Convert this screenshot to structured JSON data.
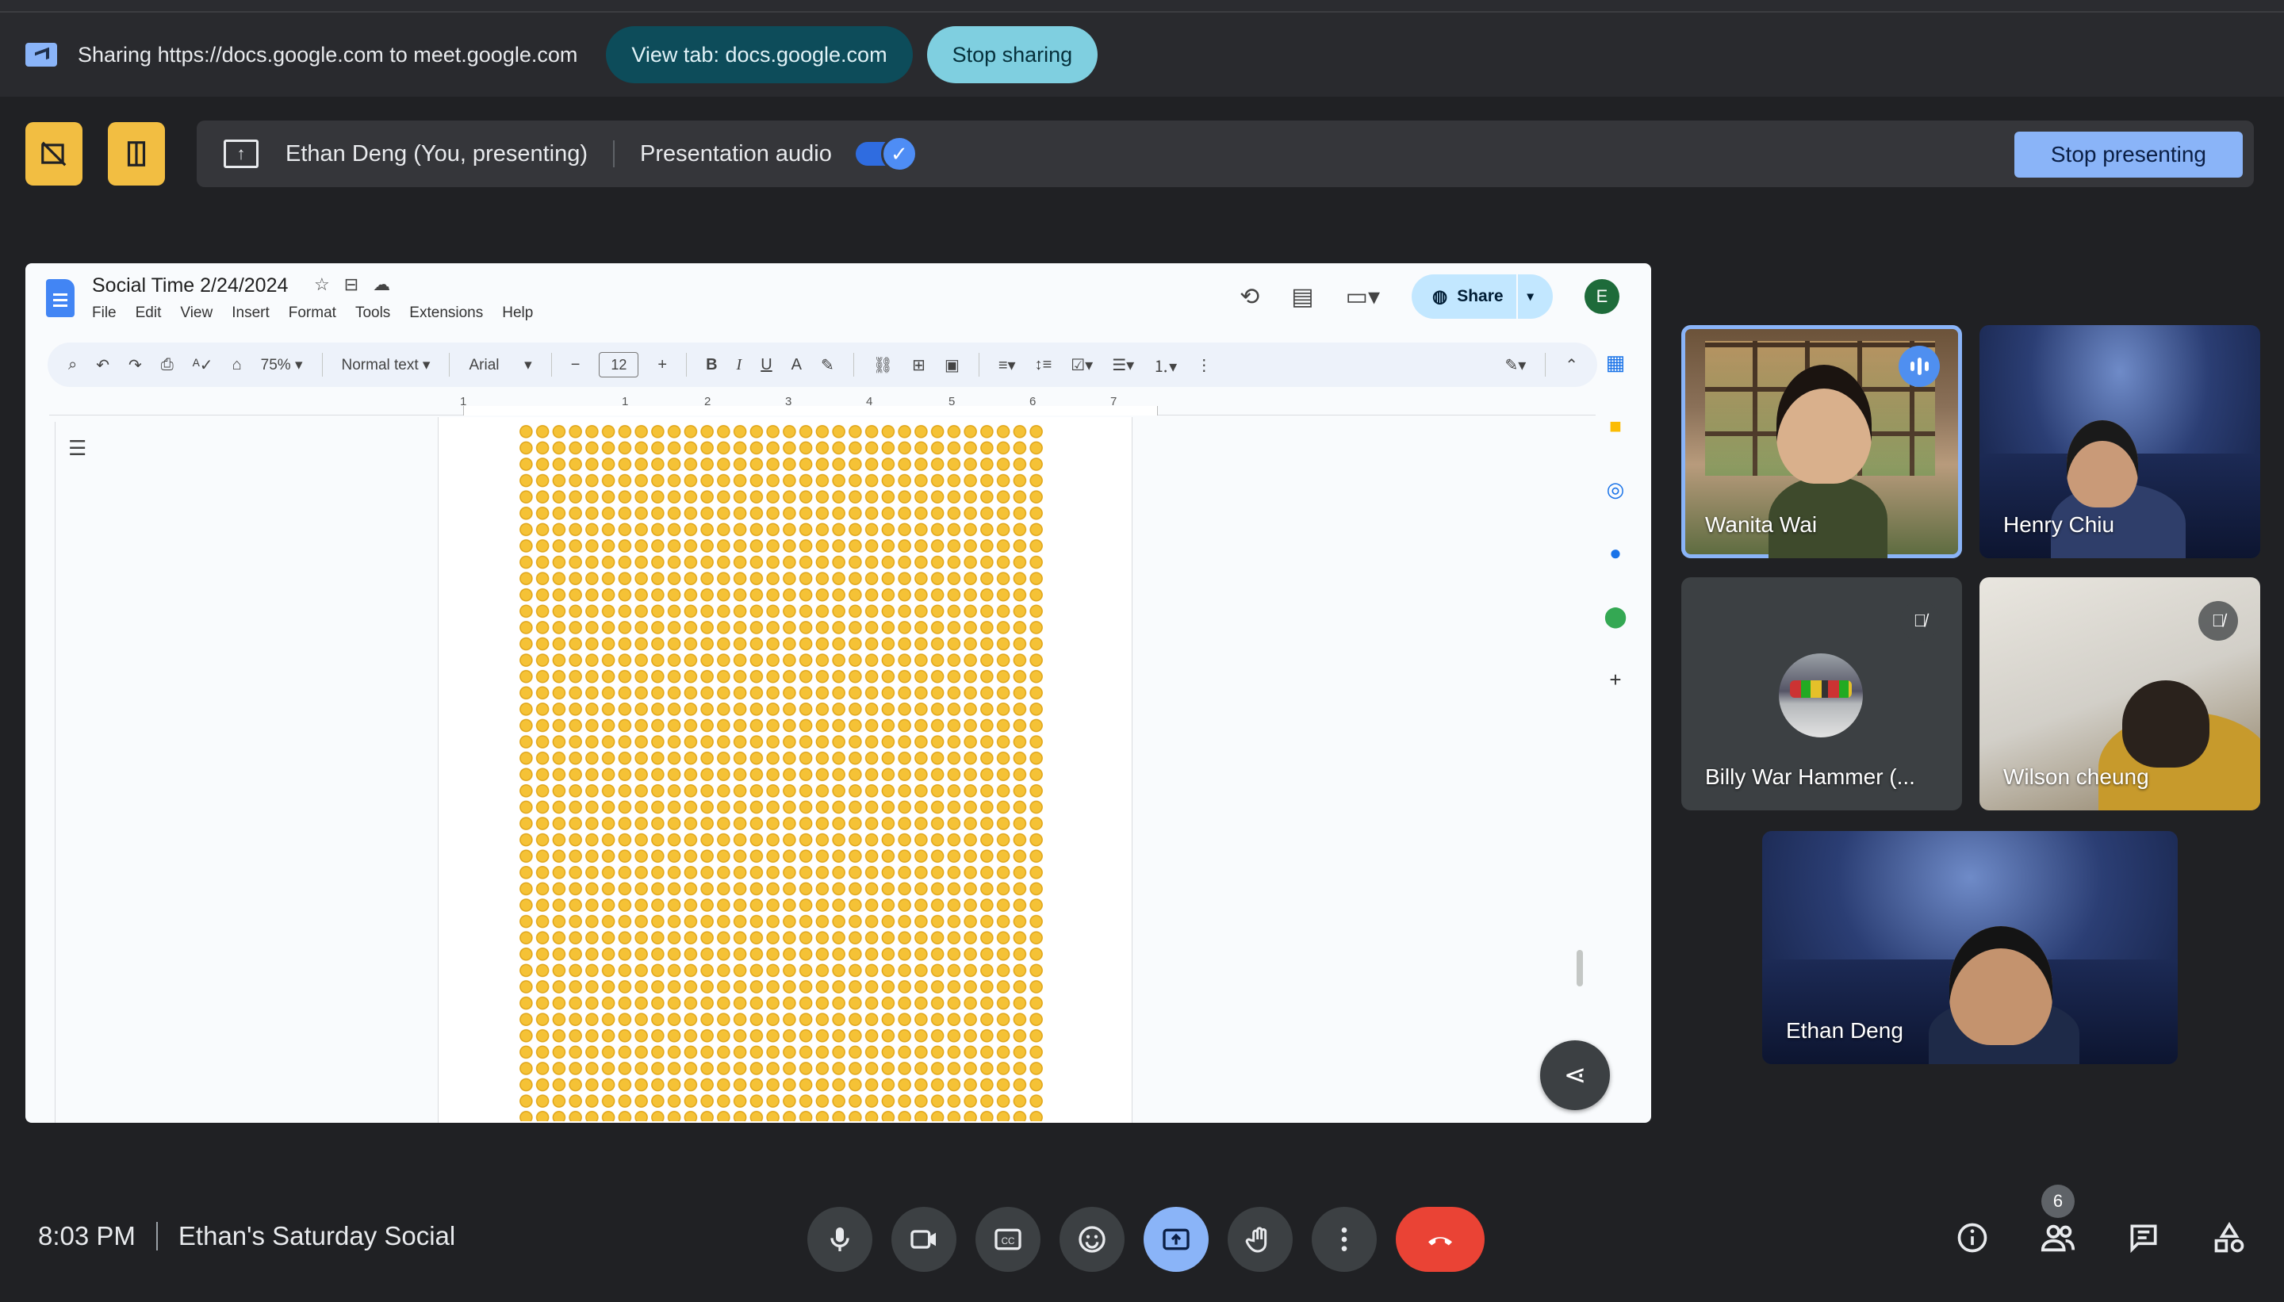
{
  "sharebar": {
    "sharing_text": "Sharing https://docs.google.com to meet.google.com",
    "view_tab_label": "View tab: docs.google.com",
    "stop_sharing_label": "Stop sharing"
  },
  "presenting": {
    "presenter_label": "Ethan Deng (You, presenting)",
    "audio_label": "Presentation audio",
    "audio_enabled": true,
    "stop_presenting_label": "Stop presenting"
  },
  "doc": {
    "title": "Social Time 2/24/2024",
    "menu": [
      "File",
      "Edit",
      "View",
      "Insert",
      "Format",
      "Tools",
      "Extensions",
      "Help"
    ],
    "share_label": "Share",
    "account_initial": "E",
    "toolbar": {
      "zoom": "75%",
      "style": "Normal text",
      "font": "Arial",
      "font_size": "12"
    },
    "ruler_numbers": [
      "1",
      "1",
      "2",
      "3",
      "4",
      "5",
      "6",
      "7"
    ],
    "content_emoji": "😊"
  },
  "participants": [
    {
      "name": "Wanita Wai",
      "state": "speaking"
    },
    {
      "name": "Henry Chiu",
      "state": "normal"
    },
    {
      "name": "Billy War Hammer (...",
      "state": "muted"
    },
    {
      "name": "Wilson cheung",
      "state": "muted"
    },
    {
      "name": "Ethan Deng",
      "state": "self"
    }
  ],
  "bottom": {
    "time": "8:03 PM",
    "meeting_name": "Ethan's Saturday Social",
    "people_count": "6"
  },
  "colors": {
    "background": "#202124",
    "accent": "#8ab4f8",
    "hangup": "#ea4335",
    "tile_button": "#f2be42"
  }
}
